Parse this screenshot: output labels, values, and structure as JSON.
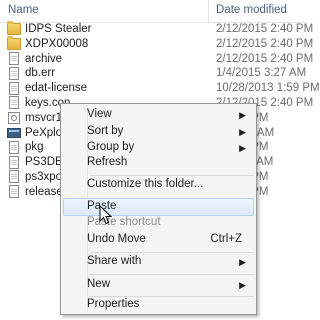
{
  "header": {
    "name_col": "Name",
    "date_col": "Date modified"
  },
  "files": [
    {
      "name": "IDPS Stealer",
      "date": "2/12/2015 2:40 PM",
      "icon": "folder-icon"
    },
    {
      "name": "XDPX00008",
      "date": "2/12/2015 2:40 PM",
      "icon": "folder-icon"
    },
    {
      "name": "archive",
      "date": "2/12/2015 2:40 PM",
      "icon": "file-icon"
    },
    {
      "name": "db.err",
      "date": "1/4/2015 3:27 AM",
      "icon": "file-icon"
    },
    {
      "name": "edat-license",
      "date": "10/28/2013 1:59 PM",
      "icon": "file-icon"
    },
    {
      "name": "keys.con",
      "date": "2/12/2015 2:40 PM",
      "icon": "file-icon"
    },
    {
      "name": "msvcr10",
      "date": "5 3:10 PM",
      "icon": "dll-icon"
    },
    {
      "name": "PeXploit",
      "date": "5 10:38 AM",
      "icon": "exe-icon"
    },
    {
      "name": "pkg",
      "date": "5 2:40 PM",
      "icon": "file-icon"
    },
    {
      "name": "PS3DB",
      "date": "5 11:00 AM",
      "icon": "file-icon"
    },
    {
      "name": "ps3xpor",
      "date": "5 2:40 PM",
      "icon": "file-icon"
    },
    {
      "name": "release",
      "date": "5 2:40 PM",
      "icon": "file-icon"
    }
  ],
  "context_menu": {
    "view": "View",
    "sort_by": "Sort by",
    "group_by": "Group by",
    "refresh": "Refresh",
    "customize": "Customize this folder...",
    "paste": "Paste",
    "paste_shortcut": "Paste shortcut",
    "undo_move": "Undo Move",
    "undo_move_shortcut": "Ctrl+Z",
    "share_with": "Share with",
    "new": "New",
    "properties": "Properties",
    "submenu_arrow": "▶"
  }
}
